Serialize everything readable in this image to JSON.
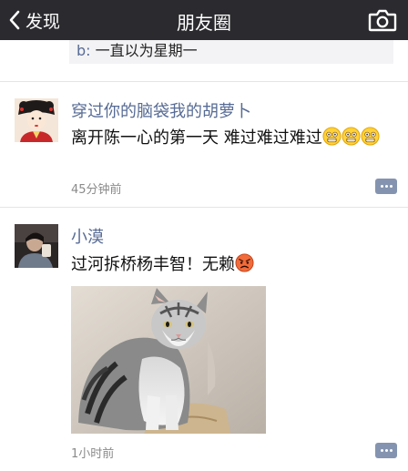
{
  "header": {
    "back_label": "发现",
    "title": "朋友圈"
  },
  "previous_comment": {
    "user": "b:",
    "text": " 一直以为星期一"
  },
  "posts": [
    {
      "username": "穿过你的脑袋我的胡萝卜",
      "text": "离开陈一心的第一天 难过难过难过",
      "emojis": [
        "grin-emoji",
        "grin-emoji",
        "grin-emoji"
      ],
      "time": "45分钟前"
    },
    {
      "username": "小漠",
      "text": "过河拆桥杨丰智！无赖",
      "emojis": [
        "angry-emoji"
      ],
      "time": "1小时前"
    }
  ],
  "colors": {
    "navbar": "#2b2b2f",
    "link": "#576b95",
    "comment_bg": "#f3f3f5"
  }
}
